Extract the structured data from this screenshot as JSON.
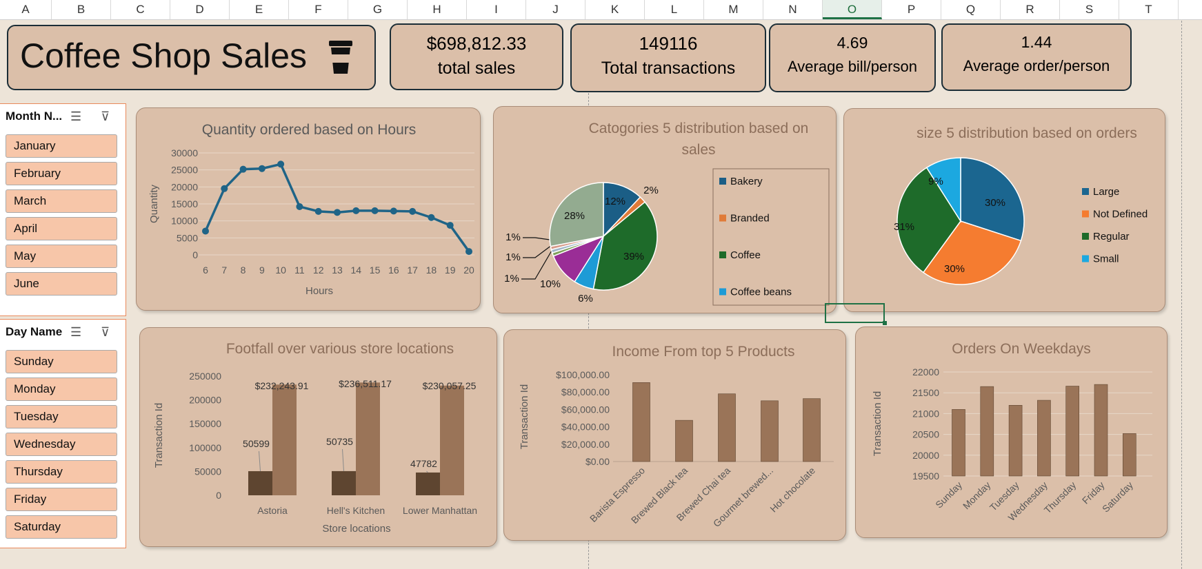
{
  "columns": [
    "A",
    "B",
    "C",
    "D",
    "E",
    "F",
    "G",
    "H",
    "I",
    "J",
    "K",
    "L",
    "M",
    "N",
    "O",
    "P",
    "Q",
    "R",
    "S",
    "T"
  ],
  "selected_column": "O",
  "header": {
    "title": "Coffee Shop Sales",
    "icon": "coffee-cup-icon"
  },
  "kpis": [
    {
      "value": "$698,812.33",
      "label": "total sales"
    },
    {
      "value": "149116",
      "label": "Total transactions"
    },
    {
      "value": "4.69",
      "label": "Average bill/person"
    },
    {
      "value": "1.44",
      "label": "Average order/person"
    }
  ],
  "month_slicer": {
    "title": "Month N...",
    "items": [
      "January",
      "February",
      "March",
      "April",
      "May",
      "June"
    ]
  },
  "day_slicer": {
    "title": "Day Name",
    "items": [
      "Sunday",
      "Monday",
      "Tuesday",
      "Wednesday",
      "Thursday",
      "Friday",
      "Saturday"
    ]
  },
  "colors": {
    "card_bg": "#dbbfa9",
    "page_bg": "#ede4d8",
    "line": "#1f6487",
    "bar_dark": "#5e4530",
    "bar_light": "#9a7458",
    "slicer_item": "#f7c6a9"
  },
  "chart_data": [
    {
      "id": "hours",
      "type": "line",
      "title": "Quantity ordered based on  Hours",
      "xlabel": "Hours",
      "ylabel": "Quantity",
      "x": [
        "6",
        "7",
        "8",
        "9",
        "10",
        "11",
        "12",
        "13",
        "14",
        "15",
        "16",
        "17",
        "18",
        "19",
        "20"
      ],
      "values": [
        7000,
        19500,
        25200,
        25400,
        26700,
        14200,
        12800,
        12500,
        13000,
        13000,
        12900,
        12800,
        11000,
        8700,
        1000
      ],
      "ylim": [
        0,
        30000
      ],
      "yticks": [
        "30000",
        "25000",
        "20000",
        "15000",
        "10000",
        "5000",
        "0"
      ],
      "grid": true
    },
    {
      "id": "categories",
      "type": "pie",
      "title": "Catogories 5 distribution based on sales",
      "legend": [
        "Bakery",
        "Branded",
        "Coffee",
        "Coffee beans"
      ],
      "legend_position": "right",
      "slices": [
        {
          "value": 12,
          "label": "12%",
          "color": "#1b5e86"
        },
        {
          "value": 2,
          "label": "2%",
          "color": "#e07b39"
        },
        {
          "value": 39,
          "label": "39%",
          "color": "#1e6b2a"
        },
        {
          "value": 6,
          "label": "6%",
          "color": "#1d9bd6"
        },
        {
          "value": 10,
          "label": "10%",
          "color": "#9a2d96"
        },
        {
          "value": 1,
          "label": "1%",
          "color": "#7fa05a"
        },
        {
          "value": 1,
          "label": "1%",
          "color": "#a0b6c8"
        },
        {
          "value": 1,
          "label": "1%",
          "color": "#d79b8a"
        },
        {
          "value": 28,
          "label": "28%",
          "color": "#93ab90"
        }
      ]
    },
    {
      "id": "size",
      "type": "pie",
      "title": "size 5 distribution based on orders",
      "legend": [
        "Large",
        "Not Defined",
        "Regular",
        "Small"
      ],
      "legend_position": "right",
      "slices": [
        {
          "value": 30,
          "label": "30%",
          "color": "#1b6690"
        },
        {
          "value": 30,
          "label": "30%",
          "color": "#f57c30"
        },
        {
          "value": 31,
          "label": "31%",
          "color": "#1e6b2a"
        },
        {
          "value": 9,
          "label": "9%",
          "color": "#1ca8e0"
        }
      ]
    },
    {
      "id": "footfall",
      "type": "bar",
      "title": "Footfall over various store locations",
      "xlabel": "Store locations",
      "ylabel": "Transaction Id",
      "categories": [
        "Astoria",
        "Hell's Kitchen",
        "Lower Manhattan"
      ],
      "series": [
        {
          "values": [
            50599,
            50735,
            47782
          ],
          "labels": [
            "50599",
            "50735",
            "47782"
          ]
        },
        {
          "values": [
            232243.91,
            236511.17,
            230057.25
          ],
          "labels": [
            "$232,243.91",
            "$236,511.17",
            "$230,057.25"
          ]
        }
      ],
      "ylim": [
        0,
        250000
      ],
      "yticks": [
        "250000",
        "200000",
        "150000",
        "100000",
        "50000",
        "0"
      ]
    },
    {
      "id": "products",
      "type": "bar",
      "title": "Income From top 5 Products",
      "ylabel": "Transaction Id",
      "categories": [
        "Barista Espresso",
        "Brewed Black tea",
        "Brewed Chai tea",
        "Gourmet brewed...",
        "Hot chocolate"
      ],
      "values": [
        91000,
        47500,
        78000,
        70000,
        72500
      ],
      "ylim": [
        0,
        100000
      ],
      "yticks": [
        "$100,000.00",
        "$80,000.00",
        "$60,000.00",
        "$40,000.00",
        "$20,000.00",
        "$0.00"
      ]
    },
    {
      "id": "weekdays",
      "type": "bar",
      "title": "Orders On Weekdays",
      "ylabel": "Transaction Id",
      "categories": [
        "Sunday",
        "Monday",
        "Tuesday",
        "Wednesday",
        "Thursday",
        "Friday",
        "Saturday"
      ],
      "values": [
        21100,
        21650,
        21200,
        21320,
        21660,
        21700,
        20520
      ],
      "ylim": [
        19500,
        22000
      ],
      "yticks": [
        "22000",
        "21500",
        "21000",
        "20500",
        "20000",
        "19500"
      ],
      "grid": true
    }
  ]
}
